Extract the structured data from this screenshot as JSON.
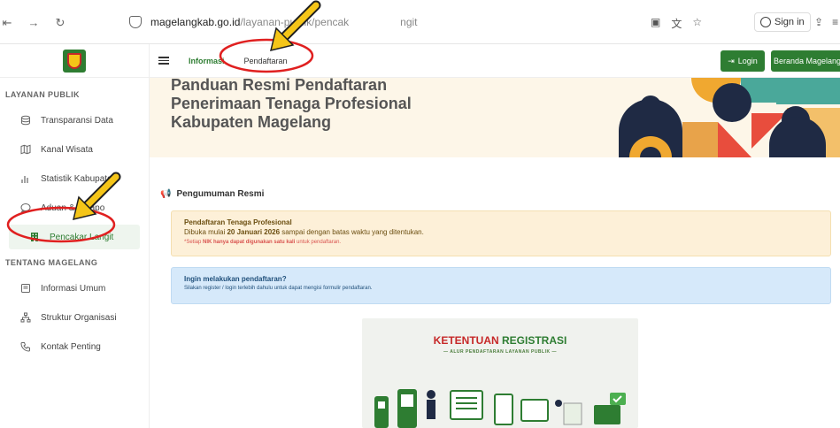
{
  "browser": {
    "url_host": "magelangkab.go.id",
    "url_path": "/layanan-publik/pencak",
    "url_path_tail": "ngit",
    "signin_label": "Sign in"
  },
  "sidebar": {
    "section1_title": "LAYANAN PUBLIK",
    "section1_items": [
      {
        "label": "Transparansi Data",
        "icon": "database-icon"
      },
      {
        "label": "Kanal Wisata",
        "icon": "map-icon"
      },
      {
        "label": "Statistik Kabupaten",
        "icon": "bar-chart-icon"
      },
      {
        "label": "Aduan & Pelapo",
        "icon": "chat-icon"
      },
      {
        "label": "Pencakar Langit",
        "icon": "building-icon",
        "active": true
      }
    ],
    "section2_title": "TENTANG MAGELANG",
    "section2_items": [
      {
        "label": "Informasi Umum",
        "icon": "document-icon"
      },
      {
        "label": "Struktur Organisasi",
        "icon": "org-chart-icon"
      },
      {
        "label": "Kontak Penting",
        "icon": "phone-icon"
      }
    ]
  },
  "header": {
    "tab_informasi": "Informasi",
    "tab_pendaftaran": "Pendaftaran",
    "login_label": "Login",
    "beranda_label": "Beranda Magelang"
  },
  "hero": {
    "title": "Panduan Resmi Pendaftaran Penerimaan Tenaga Profesional Kabupaten Magelang"
  },
  "announcement": {
    "section_title": "Pengumuman Resmi",
    "box_title": "Pendaftaran Tenaga Profesional",
    "box_line_prefix": "Dibuka mulai ",
    "box_date": "20 Januari 2026",
    "box_line_suffix": " sampai dengan batas waktu yang ditentukan.",
    "box_note_prefix": "*Setiap ",
    "box_note_bold": "NIK hanya dapat digunakan satu kali",
    "box_note_suffix": " untuk pendaftaran."
  },
  "info": {
    "title": "Ingin melakukan pendaftaran?",
    "text": "Silakan register / login terlebih dahulu untuk dapat mengisi formulir pendaftaran."
  },
  "poster": {
    "title_a": "KETENTUAN",
    "title_b": "REGISTRASI",
    "subtitle": "— ALUR PENDAFTARAN LAYANAN PUBLIK —"
  },
  "colors": {
    "brand_green": "#2e7d32",
    "announcement_bg": "#fdf0d8",
    "info_bg": "#d6e9fa",
    "highlight_red": "#e02020",
    "arrow_yellow": "#f5c518"
  }
}
